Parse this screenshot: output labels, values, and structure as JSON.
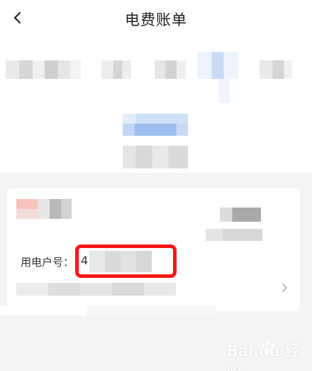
{
  "header": {
    "title": "电费账单",
    "back_icon": "chevron-left-icon"
  },
  "account": {
    "label": "用电户号：",
    "value_visible": "4",
    "more_icon": "chevron-right-icon"
  },
  "colors": {
    "page_background": "#f4f4f4",
    "card_background": "#ffffff",
    "highlight_box": "#ff1616",
    "mosaic_accent": "#9cbef0"
  },
  "watermark": {
    "text": "Bai du 经验",
    "icon": "baidu-paw-icon"
  }
}
